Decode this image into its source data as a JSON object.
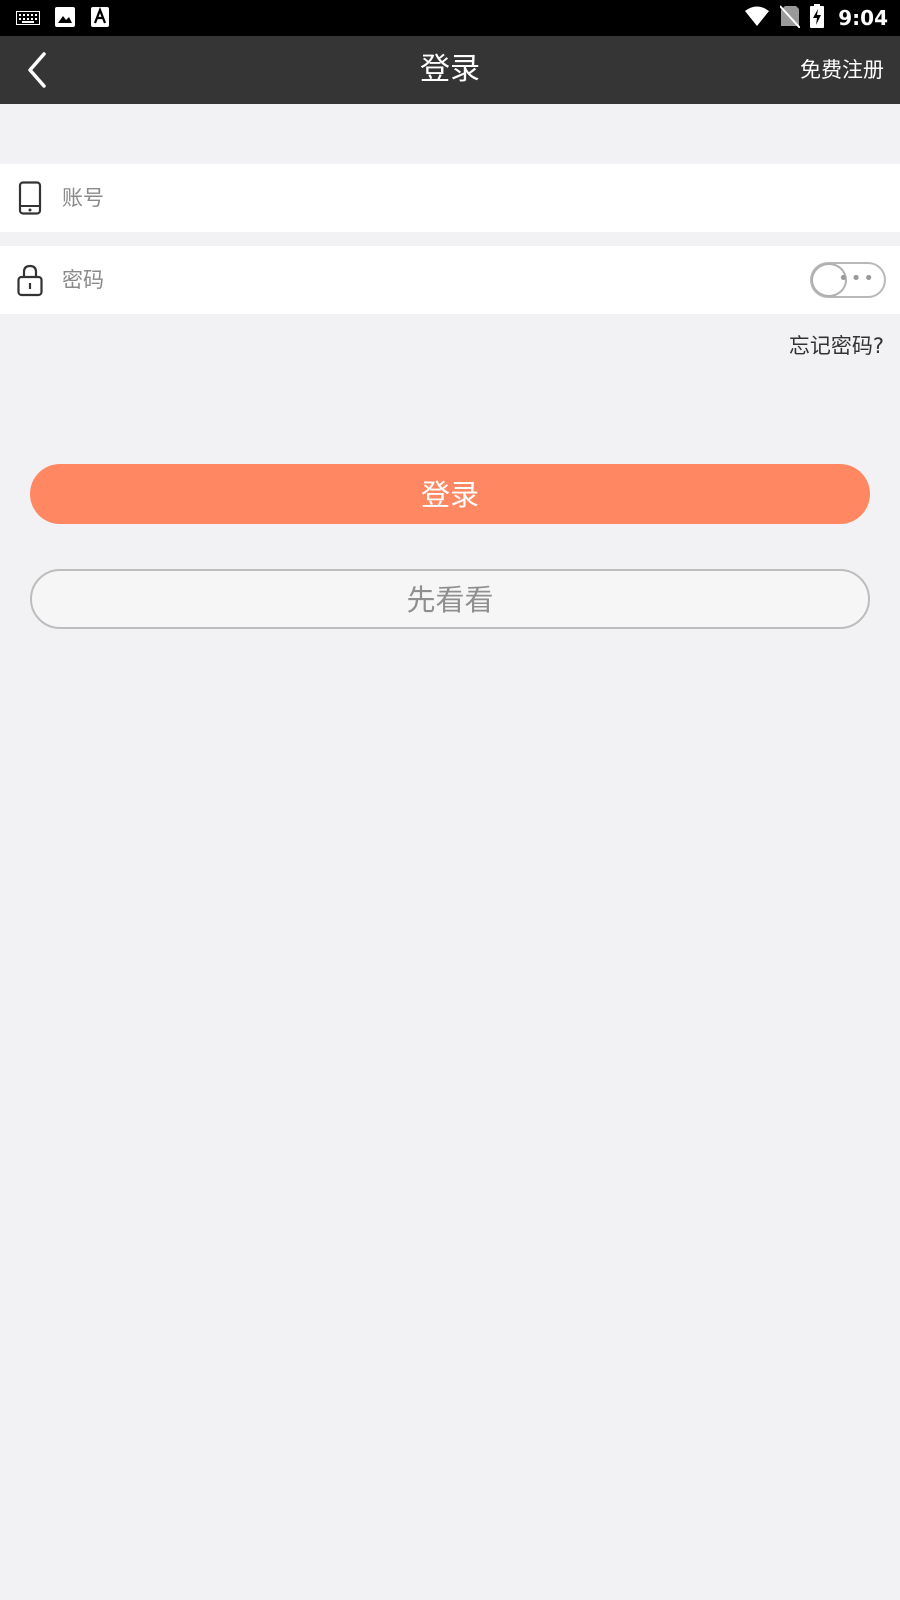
{
  "status_bar": {
    "time": "9:04",
    "left_icons": [
      "keyboard-icon",
      "image-icon",
      "text-a-icon"
    ],
    "right_icons": [
      "wifi-icon",
      "no-sim-icon",
      "battery-charging-icon"
    ]
  },
  "nav": {
    "title": "登录",
    "register_label": "免费注册",
    "back_icon": "chevron-left-icon"
  },
  "form": {
    "account_placeholder": "账号",
    "account_value": "",
    "account_icon": "phone-icon",
    "password_placeholder": "密码",
    "password_value": "",
    "password_icon": "lock-icon",
    "password_toggle_icon": "toggle-visibility-icon",
    "forgot_label": "忘记密码?"
  },
  "actions": {
    "login_label": "登录",
    "browse_label": "先看看"
  },
  "colors": {
    "nav_bg": "#353535",
    "accent": "#ff8862",
    "page_bg": "#f2f2f4"
  }
}
